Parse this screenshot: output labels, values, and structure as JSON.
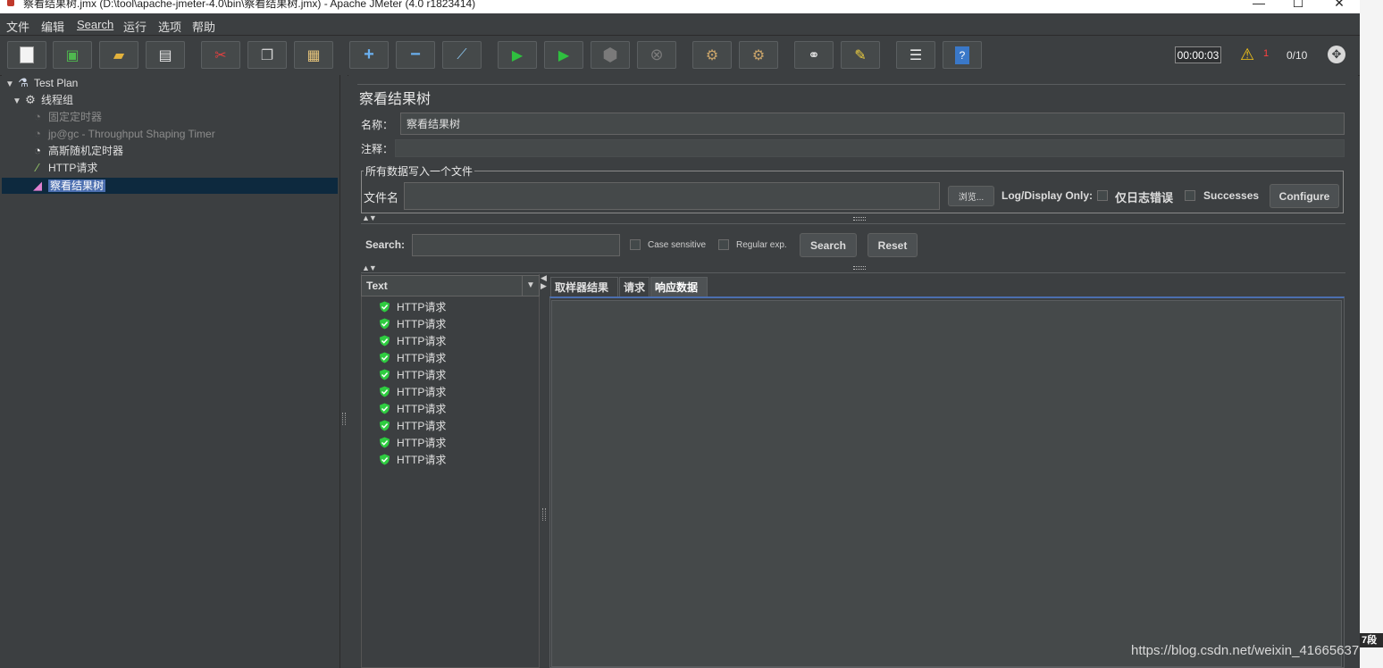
{
  "window": {
    "title": "察看结果树.jmx (D:\\tool\\apache-jmeter-4.0\\bin\\察看结果树.jmx) - Apache JMeter (4.0 r1823414)"
  },
  "menu": [
    "文件",
    "编辑",
    "Search",
    "运行",
    "选项",
    "帮助"
  ],
  "toolbar": {
    "buttons": [
      "new-icon",
      "templates-icon",
      "open-icon",
      "save-icon",
      "cut-icon",
      "copy-icon",
      "paste-icon",
      "expand-icon",
      "collapse-icon",
      "toggle-icon",
      "start-icon",
      "start-no-pause-icon",
      "stop-icon",
      "shutdown-icon",
      "clear-icon",
      "clear-all-icon",
      "search-icon",
      "reset-search-icon",
      "function-helper-icon",
      "help-icon"
    ],
    "elapsed_time": "00:00:03",
    "error_count": "1",
    "active_threads": "0/10"
  },
  "tree": {
    "nodes": [
      {
        "label": "Test Plan",
        "icon": "flask-icon"
      },
      {
        "label": "线程组",
        "icon": "gear-icon"
      },
      {
        "label": "固定定时器",
        "icon": "timer-icon",
        "disabled": true
      },
      {
        "label": "jp@gc - Throughput Shaping Timer",
        "icon": "timer-icon",
        "disabled": true
      },
      {
        "label": "高斯随机定时器",
        "icon": "timer-icon"
      },
      {
        "label": "HTTP请求",
        "icon": "sampler-icon"
      },
      {
        "label": "察看结果树",
        "icon": "listener-icon",
        "selected": true
      }
    ]
  },
  "panel": {
    "title": "察看结果树",
    "name_label": "名称：",
    "name_value": "察看结果树",
    "comment_label": "注释：",
    "comment_value": "",
    "file_group_title": "所有数据写入一个文件",
    "filename_label": "文件名",
    "filename_value": "",
    "browse_label": "浏览...",
    "log_display_label": "Log/Display Only:",
    "errors_only_label": "仅日志错误",
    "successes_label": "Successes",
    "configure_label": "Configure"
  },
  "search": {
    "label": "Search:",
    "value": "",
    "case_sensitive_label": "Case sensitive",
    "regex_label": "Regular exp.",
    "search_button": "Search",
    "reset_button": "Reset"
  },
  "results": {
    "renderer": "Text",
    "samples": [
      "HTTP请求",
      "HTTP请求",
      "HTTP请求",
      "HTTP请求",
      "HTTP请求",
      "HTTP请求",
      "HTTP请求",
      "HTTP请求",
      "HTTP请求",
      "HTTP请求"
    ],
    "tabs": [
      "取样器结果",
      "请求",
      "响应数据"
    ],
    "selected_tab": "响应数据"
  },
  "overlay": {
    "watermark": "https://blog.csdn.net/weixin_41665637",
    "corner_text": "7段"
  },
  "colors": {
    "background": "#3c3f41",
    "selection": "#4b6eaf",
    "warning": "#f5c518",
    "error": "#ff4040",
    "success_icon": "#2ecc40"
  }
}
